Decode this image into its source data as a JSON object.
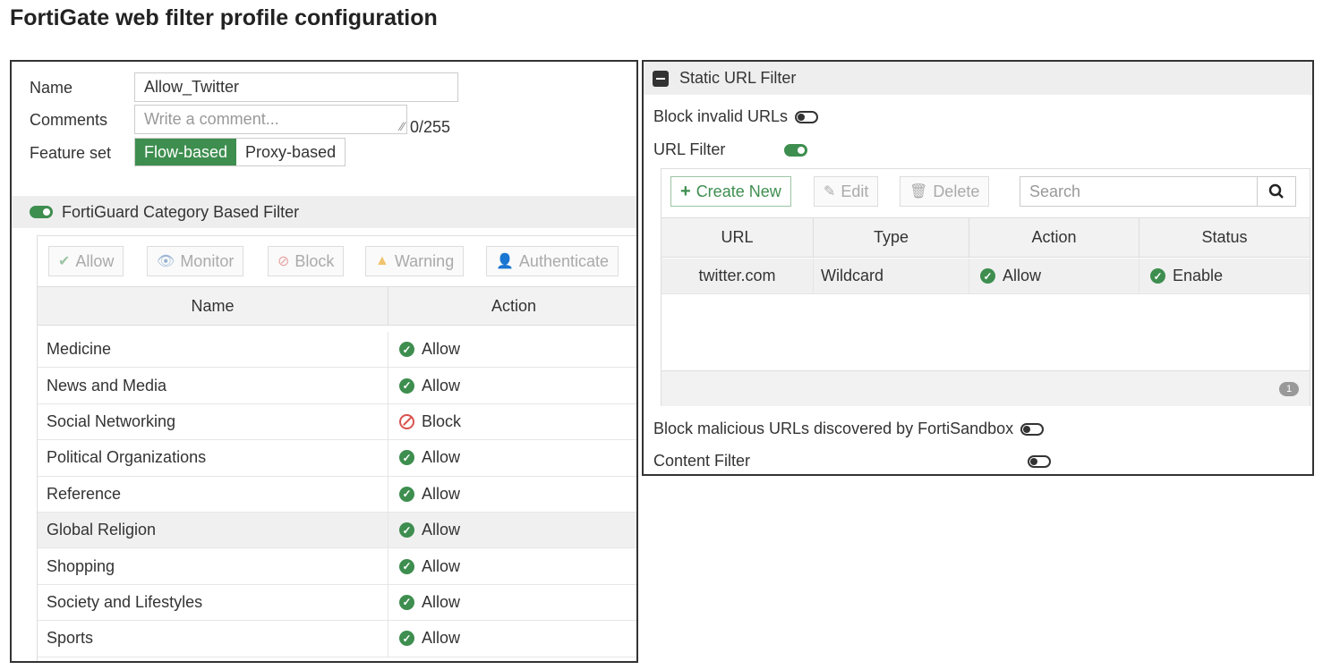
{
  "title": "FortiGate web filter profile configuration",
  "form": {
    "name_label": "Name",
    "name_value": "Allow_Twitter",
    "comments_label": "Comments",
    "comments_placeholder": "Write a comment...",
    "comments_counter": "0/255",
    "feature_set_label": "Feature set",
    "feature_set_options": [
      "Flow-based",
      "Proxy-based"
    ],
    "feature_set_selected": "Flow-based"
  },
  "category_filter": {
    "header": "FortiGuard Category Based Filter",
    "enabled": true,
    "actions": [
      "Allow",
      "Monitor",
      "Block",
      "Warning",
      "Authenticate"
    ],
    "columns": [
      "Name",
      "Action"
    ],
    "rows": [
      {
        "name": "Medicine",
        "action": "Allow",
        "status": "allow"
      },
      {
        "name": "News and Media",
        "action": "Allow",
        "status": "allow"
      },
      {
        "name": "Social Networking",
        "action": "Block",
        "status": "block"
      },
      {
        "name": "Political Organizations",
        "action": "Allow",
        "status": "allow"
      },
      {
        "name": "Reference",
        "action": "Allow",
        "status": "allow"
      },
      {
        "name": "Global Religion",
        "action": "Allow",
        "status": "allow"
      },
      {
        "name": "Shopping",
        "action": "Allow",
        "status": "allow"
      },
      {
        "name": "Society and Lifestyles",
        "action": "Allow",
        "status": "allow"
      },
      {
        "name": "Sports",
        "action": "Allow",
        "status": "allow"
      }
    ]
  },
  "static_url": {
    "header": "Static URL Filter",
    "block_invalid_label": "Block invalid URLs",
    "block_invalid_enabled": false,
    "url_filter_label": "URL Filter",
    "url_filter_enabled": true,
    "toolbar": {
      "create_new": "Create New",
      "edit": "Edit",
      "delete": "Delete",
      "search_placeholder": "Search"
    },
    "columns": [
      "URL",
      "Type",
      "Action",
      "Status"
    ],
    "rows": [
      {
        "url": "twitter.com",
        "type": "Wildcard",
        "action": "Allow",
        "status": "Enable"
      }
    ],
    "count": "1",
    "block_malicious_label": "Block malicious URLs discovered by FortiSandbox",
    "block_malicious_enabled": false,
    "content_filter_label": "Content Filter",
    "content_filter_enabled": false
  },
  "colors": {
    "accent_green": "#3e8e4f",
    "block_red": "#d9534f"
  }
}
